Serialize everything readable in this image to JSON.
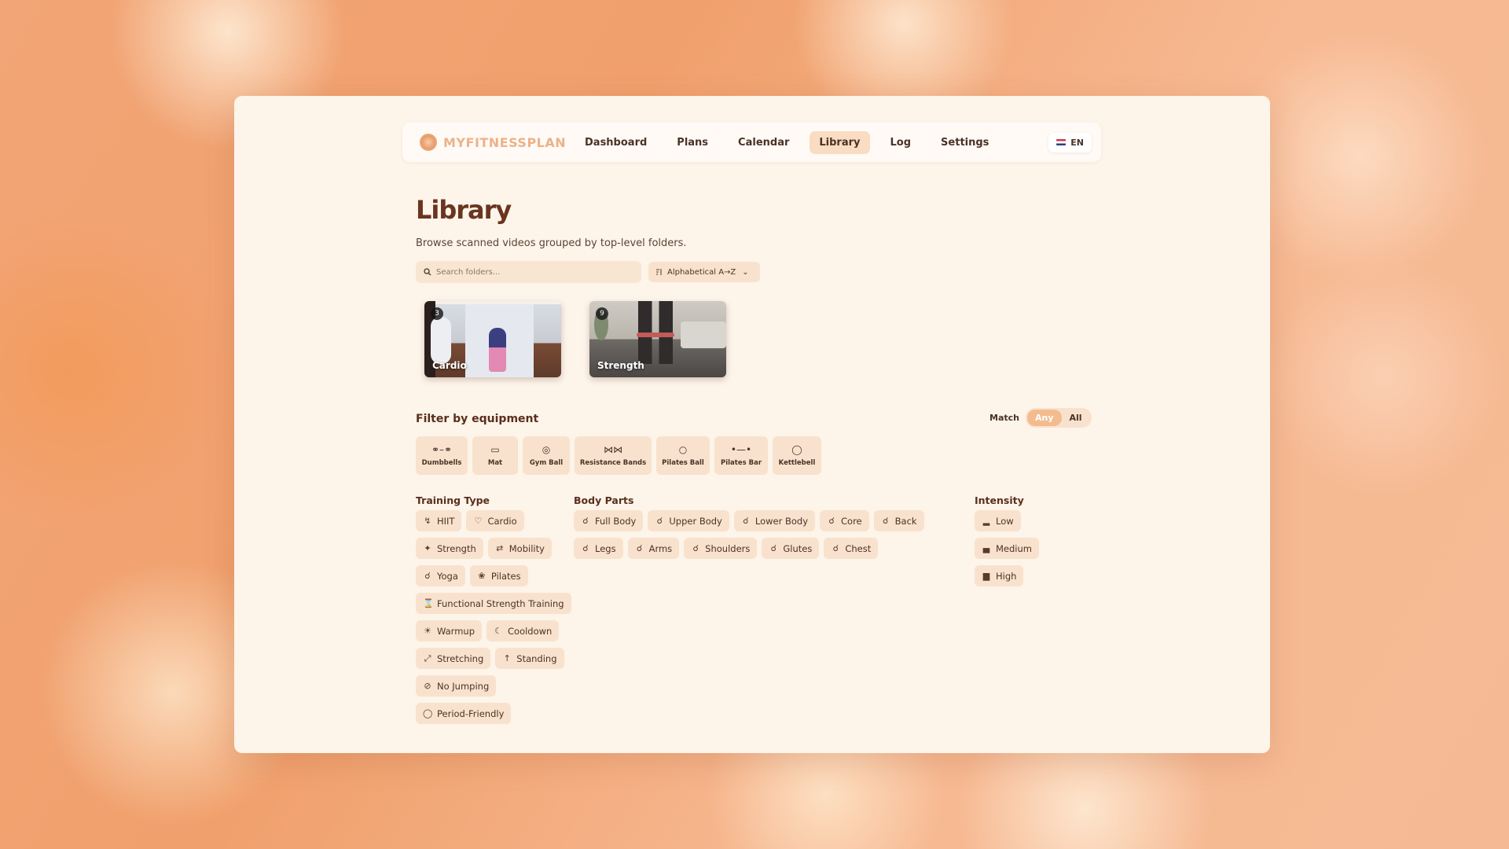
{
  "brand": {
    "name": "MYFITNESSPLAN"
  },
  "nav": {
    "links": [
      "Dashboard",
      "Plans",
      "Calendar",
      "Library",
      "Log",
      "Settings"
    ],
    "active": "Library",
    "language": "EN"
  },
  "page": {
    "title": "Library",
    "subtitle": "Browse scanned videos grouped by top-level folders."
  },
  "search": {
    "placeholder": "Search folders..."
  },
  "sort": {
    "label": "Alphabetical A→Z"
  },
  "folders": [
    {
      "name": "Cardio",
      "count": "3"
    },
    {
      "name": "Strength",
      "count": "9"
    }
  ],
  "equipment": {
    "title": "Filter by equipment",
    "match_label": "Match",
    "match_options": [
      "Any",
      "All"
    ],
    "match_selected": "Any",
    "items": [
      {
        "label": "Dumbbells",
        "icon": "dumbbell-icon"
      },
      {
        "label": "Mat",
        "icon": "mat-icon"
      },
      {
        "label": "Gym Ball",
        "icon": "ball-icon"
      },
      {
        "label": "Resistance Bands",
        "icon": "band-icon"
      },
      {
        "label": "Pilates Ball",
        "icon": "pilates-ball-icon"
      },
      {
        "label": "Pilates Bar",
        "icon": "bar-icon"
      },
      {
        "label": "Kettlebell",
        "icon": "kettlebell-icon"
      }
    ]
  },
  "training_type": {
    "title": "Training Type",
    "items": [
      "HIIT",
      "Cardio",
      "Strength",
      "Mobility",
      "Yoga",
      "Pilates",
      "Functional Strength Training",
      "Warmup",
      "Cooldown",
      "Stretching",
      "Standing",
      "No Jumping",
      "Period-Friendly"
    ]
  },
  "body_parts": {
    "title": "Body Parts",
    "items": [
      "Full Body",
      "Upper Body",
      "Lower Body",
      "Core",
      "Back",
      "Legs",
      "Arms",
      "Shoulders",
      "Glutes",
      "Chest"
    ]
  },
  "intensity": {
    "title": "Intensity",
    "items": [
      "Low",
      "Medium",
      "High"
    ]
  },
  "colors": {
    "accent": "#f3bc8f",
    "chip": "#f9e2cd",
    "panel": "#fdf4ea",
    "brand": "#eab38a"
  }
}
